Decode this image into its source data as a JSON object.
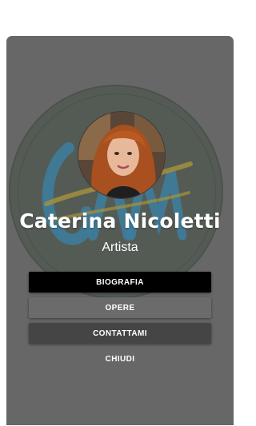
{
  "profile": {
    "name": "Caterina Nicoletti",
    "role": "Artista"
  },
  "buttons": {
    "biography": "BIOGRAFIA",
    "works": "OPERE",
    "contact": "CONTATTAMI",
    "close": "CHIUDI"
  },
  "colors": {
    "card": "#676767",
    "disc": "#545b55",
    "monogram_blue": "#3d7fa0",
    "monogram_gold": "#a8923a",
    "button_biography": "#000000",
    "button_works": "#6b6b6b",
    "button_contact": "#454545"
  }
}
